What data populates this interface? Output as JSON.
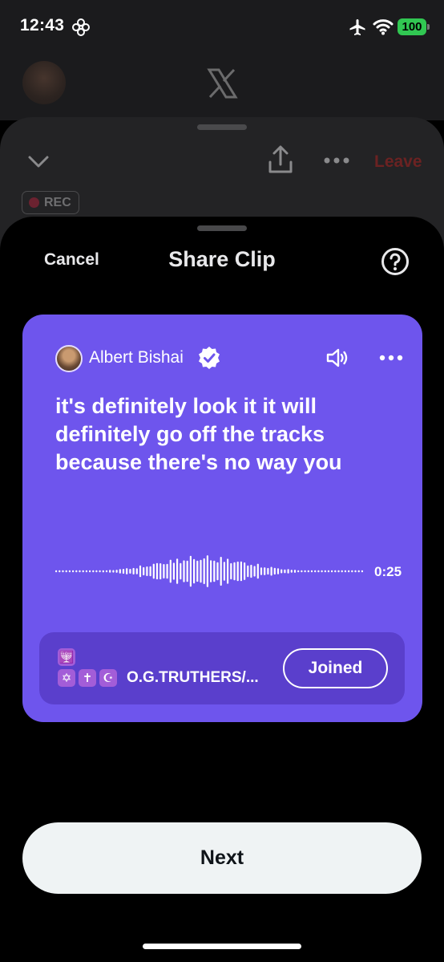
{
  "status_bar": {
    "time": "12:43",
    "time_icon": "flower-focus-icon",
    "battery": "100",
    "battery_color": "#31c752"
  },
  "space": {
    "leave_label": "Leave",
    "rec_label": "REC",
    "icons": [
      "chevron-down-icon",
      "share-icon",
      "more-icon"
    ]
  },
  "sheet": {
    "cancel_label": "Cancel",
    "title": "Share Clip",
    "help_icon": "question-circle-icon"
  },
  "clip": {
    "card_color": "#6e55ed",
    "host_name": "Albert Bishai",
    "verified": true,
    "transcript": "it's definitely look it it will definitely go off the tracks because there's no way you",
    "duration": "0:25",
    "community": {
      "emojis_row1": [
        "🕎"
      ],
      "emojis_row2": [
        "✡",
        "✝",
        "☪"
      ],
      "name": "O.G.TRUTHERS/...",
      "joined_label": "Joined"
    }
  },
  "next_label": "Next"
}
